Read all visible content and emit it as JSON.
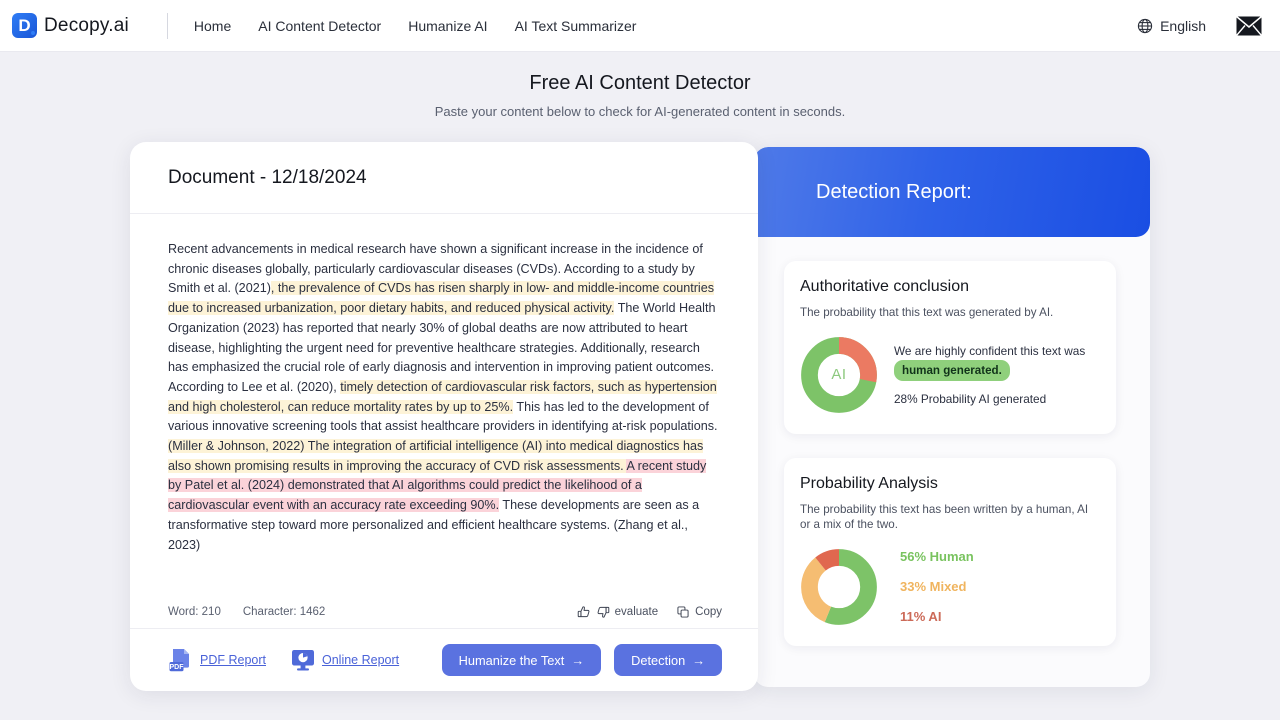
{
  "nav": {
    "brand": "Decopy.ai",
    "brand_initial": "D",
    "links": [
      "Home",
      "AI Content Detector",
      "Humanize AI",
      "AI Text Summarizer"
    ],
    "language": "English",
    "mail_icon": "envelope-icon",
    "globe_icon": "globe-icon"
  },
  "page": {
    "title": "Free AI Content Detector",
    "subtitle": "Paste your content below to check for AI-generated content in seconds."
  },
  "document": {
    "title": "Document - 12/18/2024",
    "segments": [
      {
        "text": "Recent advancements in medical research have shown a significant increase in the incidence of chronic diseases globally, particularly cardiovascular diseases (CVDs). According to a study by Smith et al. (2021)",
        "highlight": "none"
      },
      {
        "text": ", the prevalence of CVDs has risen sharply in low- and middle-income countries due to increased urbanization, poor dietary habits, and reduced physical activity.",
        "highlight": "yellow"
      },
      {
        "text": " The World Health Organization (2023) has reported that nearly 30% of global deaths are now attributed to heart disease, highlighting the urgent need for preventive healthcare strategies. Additionally, research has emphasized the crucial role of early diagnosis and intervention in improving patient outcomes. According to Lee et al. (2020), ",
        "highlight": "none"
      },
      {
        "text": "timely detection of cardiovascular risk factors, such as hypertension and high cholesterol, can reduce mortality rates by up to 25%.",
        "highlight": "yellow"
      },
      {
        "text": " This has led to the development of various innovative screening tools that assist healthcare providers in identifying at-risk populations. ",
        "highlight": "none"
      },
      {
        "text": "(Miller & Johnson, 2022) The integration of artificial intelligence (AI) into medical diagnostics has also shown promising results in improving the accuracy of CVD risk assessments. ",
        "highlight": "yellow"
      },
      {
        "text": "A recent study by Patel et al. (2024) demonstrated that AI algorithms could predict the likelihood of a cardiovascular event with an accuracy rate exceeding 90%.",
        "highlight": "pink"
      },
      {
        "text": " These developments are seen as a transformative step toward more personalized and efficient healthcare systems. (Zhang et al., 2023)",
        "highlight": "none"
      }
    ],
    "word_count_label": "Word: 210",
    "character_count_label": "Character: 1462",
    "evaluate_label": "evaluate",
    "copy_label": "Copy",
    "thumbs_up_icon": "thumbs-up-icon",
    "thumbs_down_icon": "thumbs-down-icon",
    "copy_icon": "copy-icon",
    "pdf_report_label": "PDF Report",
    "pdf_icon": "pdf-file-icon",
    "online_report_label": "Online Report",
    "online_icon": "monitor-chart-icon",
    "humanize_button": "Humanize the Text",
    "detection_button": "Detection",
    "arrow_icon": "arrow-right-icon"
  },
  "report": {
    "header_title": "Detection Report:",
    "header_gradient_from": "#4f7ae8",
    "header_gradient_to": "#1a4ee3",
    "conclusion": {
      "title": "Authoritative conclusion",
      "description": "The probability that this text was generated by AI.",
      "donut_center_label": "AI",
      "verdict_prefix": "We are highly confident this text was",
      "verdict_pill": "human generated.",
      "probability_line": "28% Probability AI generated"
    },
    "analysis": {
      "title": "Probability Analysis",
      "description": "The probability this text has been written by a human, AI or a mix of the two.",
      "legend": [
        {
          "label": "56% Human",
          "color": "#79c35f"
        },
        {
          "label": "33% Mixed",
          "color": "#f0b45e"
        },
        {
          "label": "11% AI",
          "color": "#e06a55"
        }
      ]
    }
  },
  "chart_data": [
    {
      "type": "pie",
      "title": "Authoritative conclusion",
      "categories": [
        "Human",
        "AI"
      ],
      "values": [
        72,
        28
      ],
      "colors": [
        "#7dc368",
        "#eb7a62"
      ],
      "center_label": "AI",
      "annotations": [
        "28% Probability AI generated"
      ]
    },
    {
      "type": "pie",
      "title": "Probability Analysis",
      "categories": [
        "Human",
        "Mixed",
        "AI"
      ],
      "values": [
        56,
        33,
        11
      ],
      "colors": [
        "#7dc368",
        "#f5bd72",
        "#e0684f"
      ],
      "legend_position": "right"
    }
  ]
}
